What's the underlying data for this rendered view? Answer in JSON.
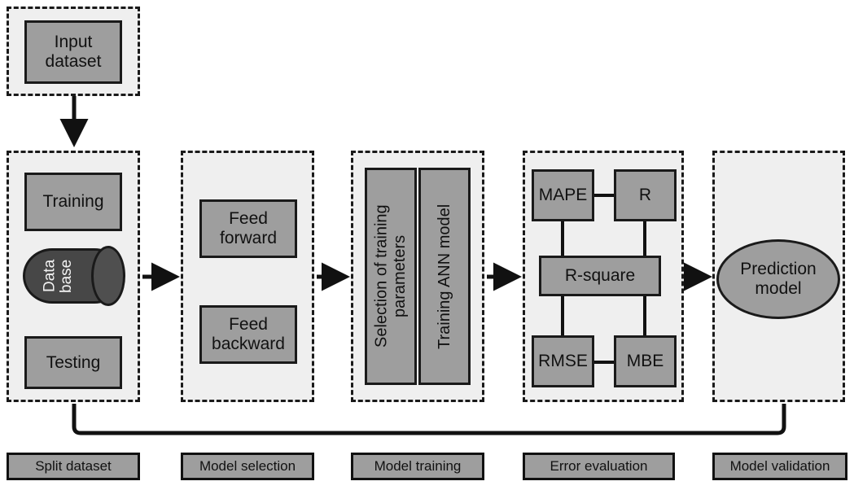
{
  "diagram": {
    "title": "ANN modelling workflow flowchart",
    "colors": {
      "group_fill": "#efefef",
      "group_border": "#1a1a1a",
      "node_fill": "#9e9e9e",
      "node_border": "#1a1a1a",
      "database_fill": "#474747",
      "line": "#111111",
      "page_background": "#ffffff"
    },
    "input": {
      "label": "Input dataset"
    },
    "stages": [
      {
        "key": "split-dataset",
        "caption": "Split dataset",
        "nodes": [
          {
            "key": "training",
            "label": "Training",
            "shape": "rect"
          },
          {
            "key": "database",
            "label": "Data base",
            "shape": "cylinder"
          },
          {
            "key": "testing",
            "label": "Testing",
            "shape": "rect"
          }
        ]
      },
      {
        "key": "model-selection",
        "caption": "Model selection",
        "nodes": [
          {
            "key": "feed-forward",
            "label": "Feed forward",
            "shape": "rect"
          },
          {
            "key": "feed-backward",
            "label": "Feed backward",
            "shape": "rect"
          }
        ]
      },
      {
        "key": "model-training",
        "caption": "Model training",
        "nodes": [
          {
            "key": "selection-of-training-parameters",
            "label": "Selection of training parameters",
            "shape": "rect-vertical"
          },
          {
            "key": "training-ann-model",
            "label": "Training ANN model",
            "shape": "rect-vertical"
          }
        ]
      },
      {
        "key": "error-evaluation",
        "caption": "Error evaluation",
        "nodes": [
          {
            "key": "mape",
            "label": "MAPE",
            "shape": "rect"
          },
          {
            "key": "r",
            "label": "R",
            "shape": "rect"
          },
          {
            "key": "r-square",
            "label": "R-square",
            "shape": "rect"
          },
          {
            "key": "rmse",
            "label": "RMSE",
            "shape": "rect"
          },
          {
            "key": "mbe",
            "label": "MBE",
            "shape": "rect"
          }
        ]
      },
      {
        "key": "model-validation",
        "caption": "Model validation",
        "nodes": [
          {
            "key": "prediction-model",
            "label": "Prediction model",
            "shape": "ellipse"
          }
        ]
      }
    ],
    "connections": {
      "input_to_split": "arrow-down",
      "split_to_selection": "arrow-right",
      "selection_to_training": "arrow-right",
      "training_to_error": "arrow-right",
      "error_to_validation": "arrow-right",
      "validation_feedback_to_split": "feedback-loop"
    }
  }
}
